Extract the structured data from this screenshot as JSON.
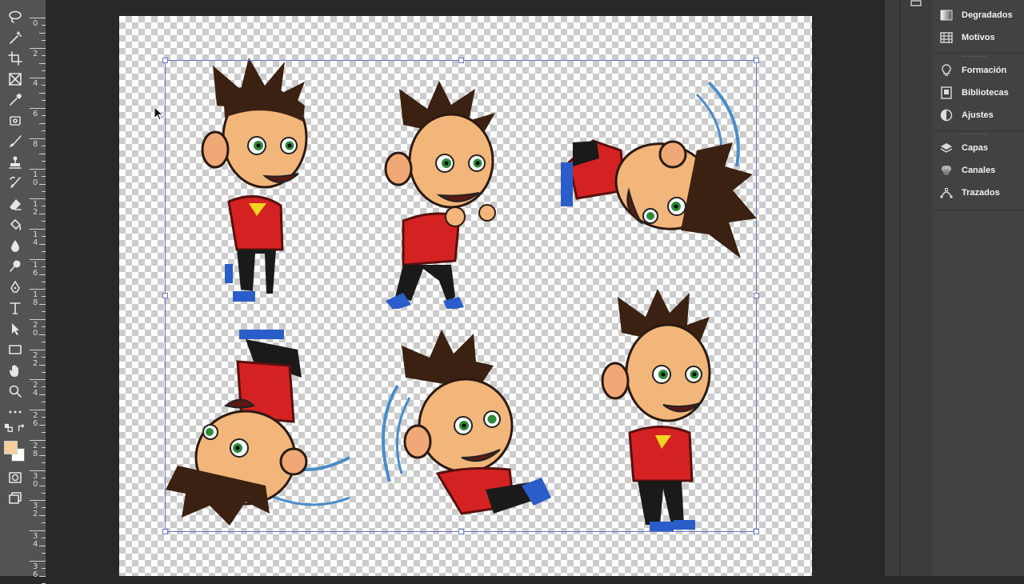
{
  "app": {
    "accent_color": "#6b74c9",
    "foreground_color": "#f4cf9a",
    "background_color": "#ffffff"
  },
  "toolbar": {
    "tools": [
      "lasso-tool-icon",
      "magic-wand-icon",
      "crop-tool-icon",
      "frame-tool-icon",
      "eyedropper-icon",
      "spot-healing-icon",
      "brush-tool-icon",
      "clone-stamp-icon",
      "history-brush-icon",
      "eraser-icon",
      "paint-bucket-icon",
      "blur-tool-icon",
      "dodge-tool-icon",
      "pen-tool-icon",
      "type-tool-icon",
      "path-selection-icon",
      "rectangle-tool-icon",
      "hand-tool-icon",
      "zoom-tool-icon",
      "more-tools-icon"
    ]
  },
  "ruler": {
    "labels": [
      "0",
      "2",
      "4",
      "6",
      "8",
      "10",
      "12",
      "14",
      "16",
      "18",
      "20",
      "22",
      "24",
      "26",
      "28",
      "30",
      "32",
      "34",
      "36"
    ]
  },
  "panels": {
    "items": [
      {
        "id": "degradados",
        "label": "Degradados",
        "icon": "gradient-icon"
      },
      {
        "id": "motivos",
        "label": "Motivos",
        "icon": "pattern-icon"
      },
      {
        "id": "formacion",
        "label": "Formación",
        "icon": "lightbulb-icon"
      },
      {
        "id": "bibliotecas",
        "label": "Bibliotecas",
        "icon": "libraries-icon"
      },
      {
        "id": "ajustes",
        "label": "Ajustes",
        "icon": "adjustments-icon"
      },
      {
        "id": "capas",
        "label": "Capas",
        "icon": "layers-icon"
      },
      {
        "id": "canales",
        "label": "Canales",
        "icon": "channels-icon"
      },
      {
        "id": "trazados",
        "label": "Trazados",
        "icon": "paths-icon"
      }
    ]
  },
  "canvas": {
    "sprites": [
      {
        "name": "character-idle-sprite"
      },
      {
        "name": "character-run-sprite"
      },
      {
        "name": "character-spin-sprite"
      },
      {
        "name": "character-flip-sprite"
      },
      {
        "name": "character-roll-sprite"
      },
      {
        "name": "character-stand-sprite"
      }
    ]
  }
}
